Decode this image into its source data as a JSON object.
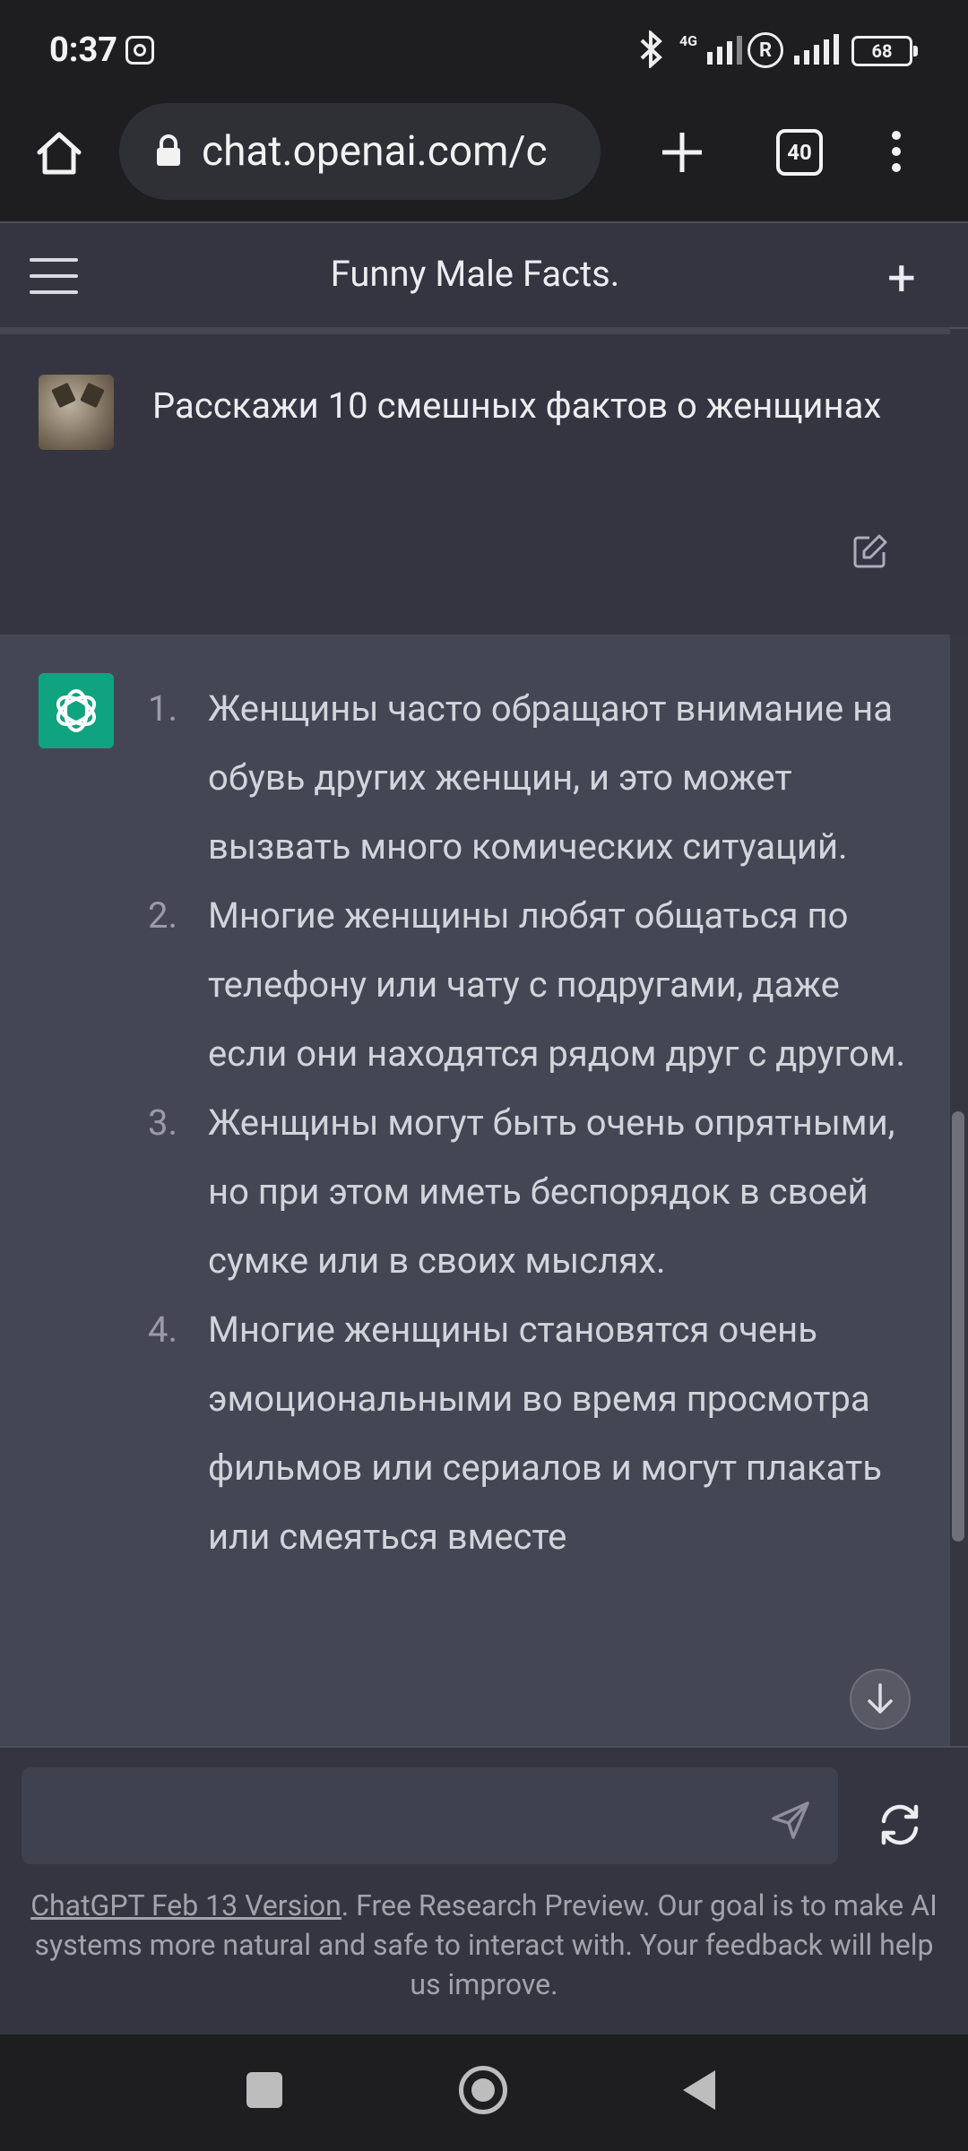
{
  "status_bar": {
    "time": "0:37",
    "network_label": "4G",
    "roaming_label": "R",
    "battery": "68",
    "icons": [
      "instagram-icon",
      "bluetooth-icon",
      "signal-icon",
      "roaming-icon",
      "battery-icon"
    ]
  },
  "browser": {
    "url": "chat.openai.com/c",
    "tab_count": "40",
    "icons": [
      "home-icon",
      "lock-icon",
      "new-tab-icon",
      "tabs-icon",
      "menu-icon"
    ]
  },
  "chat_header": {
    "title": "Funny Male Facts."
  },
  "user_message": {
    "text": "Расскажи 10 смешных фактов о женщинах"
  },
  "assistant_message": {
    "items": [
      {
        "num": "1.",
        "text": "Женщины часто обращают внимание на обувь других женщин, и это может вызвать много комических ситуаций."
      },
      {
        "num": "2.",
        "text": "Многие женщины любят общаться по телефону или чату с подругами, даже если они находятся рядом друг с другом."
      },
      {
        "num": "3.",
        "text": "Женщины могут быть очень опрятными, но при этом иметь беспорядок в своей сумке или в своих мыслях."
      },
      {
        "num": "4.",
        "text": "Многие женщины становятся очень эмоциональными во время просмотра фильмов или сериалов и могут плакать или смеяться вместе"
      }
    ]
  },
  "composer": {
    "placeholder": "",
    "value": ""
  },
  "footer": {
    "version_link": "ChatGPT Feb 13 Version",
    "text": ". Free Research Preview. Our goal is to make AI systems more natural and safe to interact with. Your feedback will help us improve."
  },
  "colors": {
    "page_bg": "#343541",
    "assistant_bg": "#444654",
    "openai_green": "#10a37f",
    "system_bar": "#1e1e20"
  }
}
